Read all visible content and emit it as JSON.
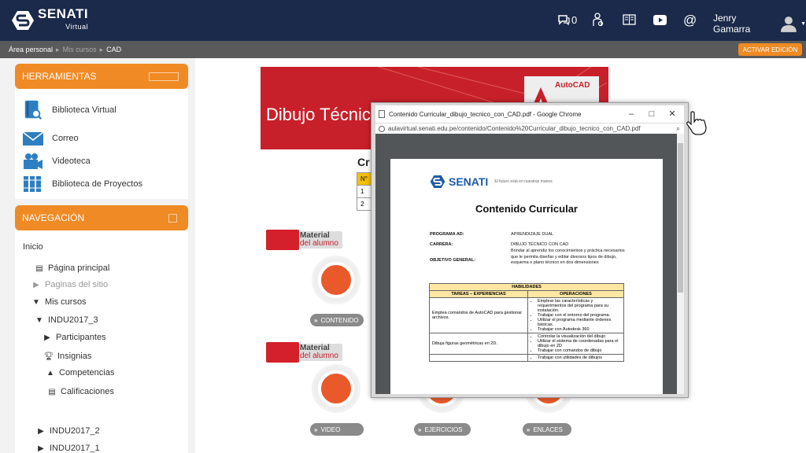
{
  "topbar": {
    "logo_text": "SENATI",
    "logo_sub": "Virtual",
    "messages_count": "0",
    "user_name": "Jenry Gamarra",
    "icons": [
      "chat-icon",
      "instructor-icon",
      "book-icon",
      "youtube-icon",
      "at-icon",
      "avatar-icon"
    ]
  },
  "breadcrumb": {
    "items": [
      "Área personal",
      "Mis cursos",
      "CAD"
    ]
  },
  "edit_button": "ACTIVAR EDICIÓN",
  "tools_block": {
    "title": "HERRAMIENTAS",
    "items": [
      "Biblioteca Virtual",
      "Correo",
      "Videoteca",
      "Biblioteca de Proyectos"
    ]
  },
  "nav_block": {
    "title": "NAVEGACIÓN",
    "home": "Inicio",
    "items": [
      "Página principal",
      "Paginas del sitio",
      "Mis cursos",
      "INDU2017_3",
      "Participantes",
      "Insignias",
      "Competencias",
      "Calificaciones",
      "INDU2017_2",
      "INDU2017_1"
    ]
  },
  "course": {
    "banner_title": "Dibujo Técnico",
    "banner_badge": "AutoCAD",
    "section_title": "Cr",
    "table": {
      "header": "N°",
      "rows": [
        "1",
        "2"
      ]
    },
    "material_label_1": "Material",
    "material_label_2": "del alumno",
    "buttons": [
      "CONTENIDO",
      "VIDEO",
      "EJERCICIOS",
      "ENLACES"
    ]
  },
  "pdf_window": {
    "title": "Contenido Curricular_dibujo_tecnico_con_CAD.pdf - Google Chrome",
    "url": "aulavirtual.senati.edu.pe/contenido/Contenido%20Curricular_dibujo_tecnico_con_CAD.pdf",
    "doc": {
      "logo": "SENATI",
      "slogan": "El futuro está en nuestras manos",
      "title": "Contenido Curricular",
      "fields": [
        {
          "label": "PROGRAMA AD:",
          "value": "APRENDIZAJE DUAL"
        },
        {
          "label": "CARRERA:",
          "value": "DIBUJO TÉCNICO CON CAD"
        },
        {
          "label": "OBJETIVO GENERAL:",
          "value": "Brindar al aprendiz los conocimientos y práctica necesarios que le permita diseñar y editar diversos tipos de dibujo, esquema o plano técnico en dos dimensiones"
        }
      ],
      "table_title": "HABILIDADES",
      "col1": "TAREAS – EXPERIENCIAS",
      "col2": "OPERACIONES",
      "rows": [
        {
          "task": "Emplea comandos de AutoCAD para gestionar archivos.",
          "ops": [
            "Emplear las características y requerimientos del programa para su instalación.",
            "Trabajar con el entorno del programa.",
            "Utilizar el programa mediante órdenes básicas.",
            "Trabajar con Autodesk 360"
          ]
        },
        {
          "task": "Dibuja figuras geométricas en 2D.",
          "ops": [
            "Controlar la visualización del dibujo",
            "Utilizar el sistema de coordenadas para el dibujo en 2D",
            "Trabajar con comandos de dibujo"
          ]
        },
        {
          "task": "",
          "ops": [
            "Trabajar con utilidades de dibujos"
          ]
        }
      ]
    }
  },
  "colors": {
    "navy": "#1b2a4a",
    "orange": "#f08a24",
    "red": "#c8202a"
  }
}
